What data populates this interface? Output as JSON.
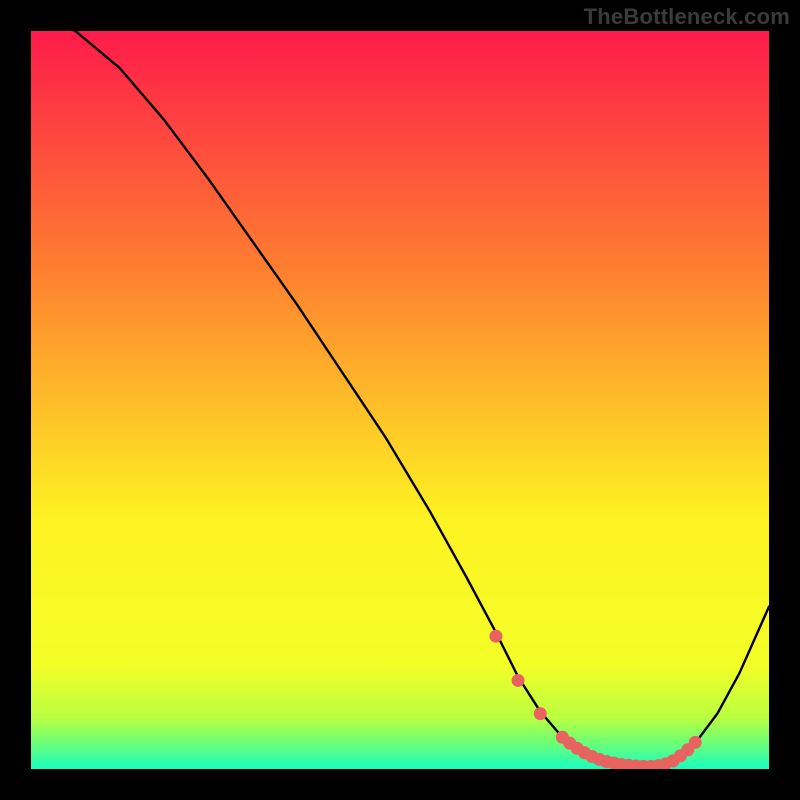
{
  "watermark": "TheBottleneck.com",
  "colors": {
    "gradient_top": "#fe1b4a",
    "gradient_mid1": "#fe812f",
    "gradient_mid2": "#fef322",
    "gradient_mid3": "#f3fe27",
    "gradient_bottom_band": "#6cfe77",
    "gradient_bottom": "#17fec0",
    "curve": "#000000",
    "marker": "#e86260",
    "frame": "#000000"
  },
  "chart_data": {
    "type": "line",
    "title": "",
    "xlabel": "",
    "ylabel": "",
    "xlim": [
      0,
      100
    ],
    "ylim": [
      0,
      100
    ],
    "series": [
      {
        "name": "bottleneck-curve",
        "x": [
          0,
          6,
          12,
          18,
          24,
          30,
          36,
          42,
          48,
          54,
          59,
          63,
          66,
          69,
          72,
          75,
          78,
          81,
          84,
          87,
          90,
          93,
          96,
          100
        ],
        "values": [
          103,
          100,
          95,
          88,
          80,
          71.5,
          63,
          54,
          45,
          35,
          26,
          18.5,
          12.5,
          7.8,
          4.3,
          2.0,
          0.8,
          0.3,
          0.3,
          1.2,
          3.5,
          7.5,
          13,
          22
        ]
      }
    ],
    "markers": {
      "name": "highlight-points",
      "x": [
        63,
        66,
        69,
        72,
        73,
        74,
        75,
        76,
        77,
        78,
        79,
        80,
        81,
        82,
        83,
        84,
        85,
        86,
        87,
        88,
        89,
        90
      ],
      "values": [
        18,
        12,
        7.5,
        4.3,
        3.5,
        2.8,
        2.2,
        1.7,
        1.3,
        1.0,
        0.8,
        0.6,
        0.5,
        0.4,
        0.35,
        0.35,
        0.45,
        0.7,
        1.1,
        1.8,
        2.6,
        3.6
      ]
    }
  }
}
